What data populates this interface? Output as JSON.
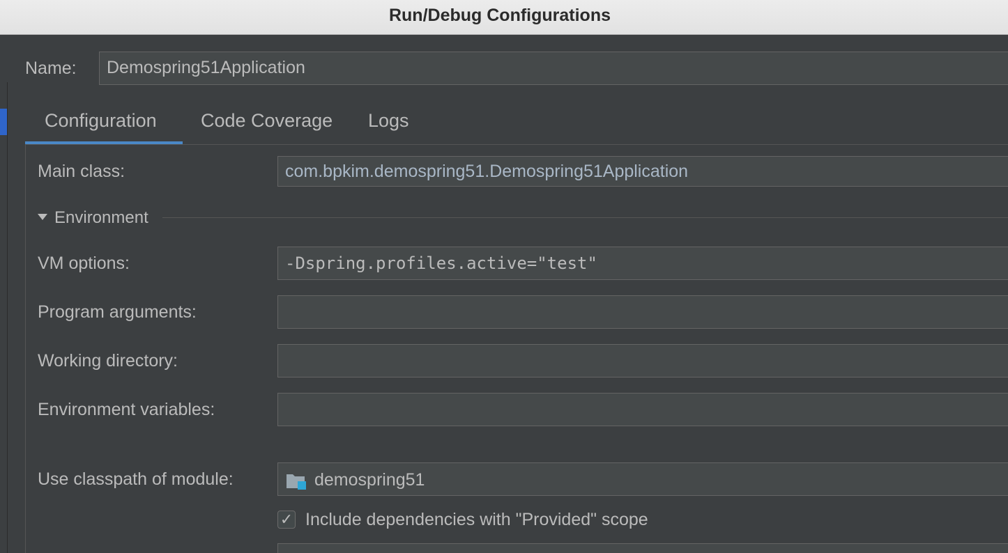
{
  "window": {
    "title": "Run/Debug Configurations"
  },
  "name": {
    "label": "Name:",
    "value": "Demospring51Application"
  },
  "tabs": [
    {
      "label": "Configuration",
      "active": true
    },
    {
      "label": "Code Coverage",
      "active": false
    },
    {
      "label": "Logs",
      "active": false
    }
  ],
  "form": {
    "main_class": {
      "label": "Main class:",
      "value": "com.bpkim.demospring51.Demospring51Application"
    },
    "environment": {
      "label": "Environment",
      "expanded": true
    },
    "vm_options": {
      "label": "VM options:",
      "value": "-Dspring.profiles.active=\"test\""
    },
    "program_arguments": {
      "label": "Program arguments:",
      "value": ""
    },
    "working_directory": {
      "label": "Working directory:",
      "value": ""
    },
    "environment_variables": {
      "label": "Environment variables:",
      "value": ""
    },
    "classpath_module": {
      "label": "Use classpath of module:",
      "value": "demospring51",
      "icon": "module-folder-icon"
    },
    "include_provided": {
      "label": "Include dependencies with \"Provided\" scope",
      "checked": true,
      "check_glyph": "✓"
    }
  },
  "colors": {
    "accent": "#4a88c7",
    "selection": "#2f65ca",
    "background": "#3c3f41",
    "field": "#45494a",
    "module_badge": "#2ea6d6"
  }
}
